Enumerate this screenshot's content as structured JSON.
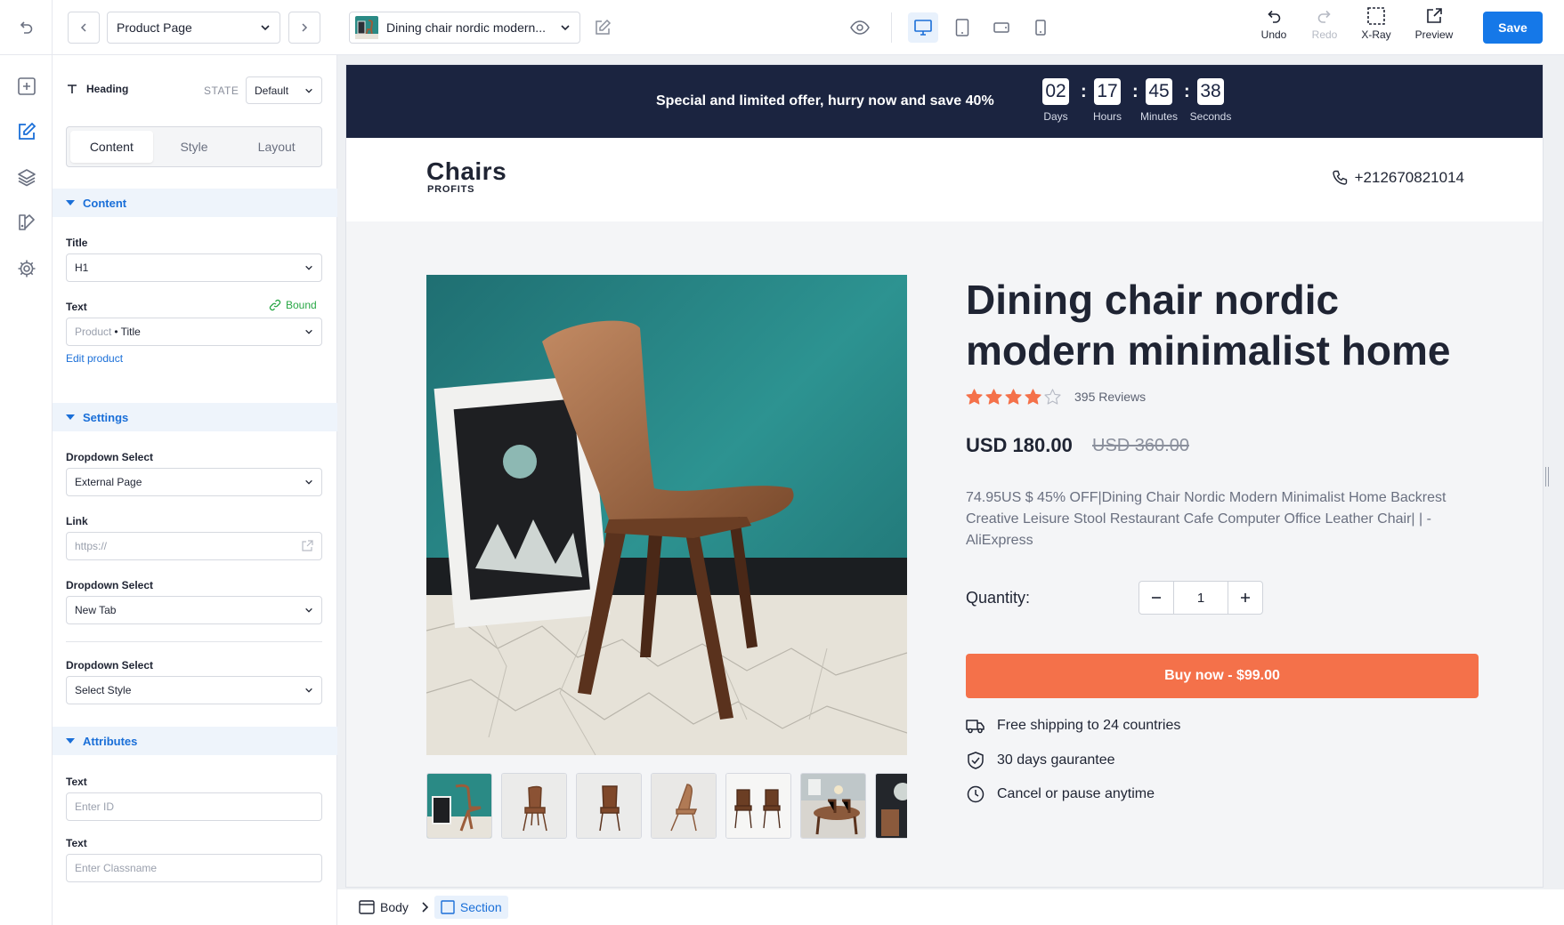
{
  "toolbar": {
    "page_select": "Product Page",
    "product_select": "Dining chair nordic modern...",
    "undo_label": "Undo",
    "redo_label": "Redo",
    "xray_label": "X-Ray",
    "preview_label": "Preview",
    "save_label": "Save",
    "active_device": "desktop"
  },
  "panel": {
    "element_label": "Heading",
    "state_label": "STATE",
    "state_value": "Default",
    "tabs": [
      "Content",
      "Style",
      "Layout"
    ],
    "active_tab": "Content",
    "content_section": "Content",
    "title_label": "Title",
    "title_value": "H1",
    "text_label": "Text",
    "bound_label": "Bound",
    "text_source": "Product",
    "text_bullet": "•",
    "text_field": "Title",
    "edit_product": "Edit product",
    "settings_section": "Settings",
    "dropdown1_label": "Dropdown Select",
    "dropdown1_value": "External Page",
    "link_label": "Link",
    "link_placeholder": "https://",
    "dropdown2_label": "Dropdown Select",
    "dropdown2_value": "New Tab",
    "dropdown3_label": "Dropdown Select",
    "dropdown3_value": "Select Style",
    "attributes_section": "Attributes",
    "attr_text1_label": "Text",
    "attr_text1_placeholder": "Enter ID",
    "attr_text2_label": "Text",
    "attr_text2_placeholder": "Enter Classname"
  },
  "page": {
    "promo_text": "Special and limited offer, hurry now and save 40%",
    "countdown": [
      {
        "value": "02",
        "label": "Days"
      },
      {
        "value": "17",
        "label": "Hours"
      },
      {
        "value": "45",
        "label": "Minutes"
      },
      {
        "value": "38",
        "label": "Seconds"
      }
    ],
    "countdown_separator": ":",
    "brand": "Chairs",
    "brand_sub": "PROFITS",
    "phone": "+212670821014",
    "title": "Dining chair nordic modern minimalist home",
    "rating": 4,
    "rating_max": 5,
    "reviews": "395 Reviews",
    "price": "USD 180.00",
    "old_price": "USD 360.00",
    "description": "74.95US $ 45% OFF|Dining Chair Nordic Modern Minimalist Home Backrest Creative Leisure Stool Restaurant Cafe Computer Office Leather Chair| | - AliExpress",
    "quantity_label": "Quantity:",
    "quantity_value": "1",
    "buy_label": "Buy now - $99.00",
    "features": [
      {
        "icon": "truck-icon",
        "text": "Free shipping to 24 countries"
      },
      {
        "icon": "shield-check-icon",
        "text": "30 days gaurantee"
      },
      {
        "icon": "clock-icon",
        "text": "Cancel or pause anytime"
      }
    ]
  },
  "breadcrumb": [
    "Body",
    "Section"
  ],
  "colors": {
    "accent": "#1578e8",
    "promo_bg": "#1b2440",
    "buy_button": "#f4714a",
    "star": "#f4714a"
  }
}
